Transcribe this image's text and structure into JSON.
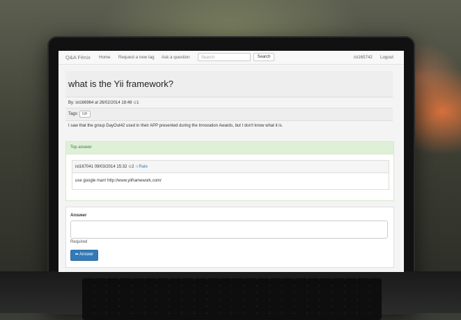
{
  "nav": {
    "brand": "Q&A Fénix",
    "links": [
      "Home",
      "Request a new tag",
      "Ask a question"
    ],
    "search_placeholder": "Search",
    "search_button": "Search",
    "user": "ist165742",
    "logout": "Logout"
  },
  "question": {
    "title": "what is the Yii framework?",
    "meta": "By: ist166964 at 26/02/2014 18:48 ",
    "votes": "1",
    "tags_label": "Tags:",
    "tags": [
      "GR"
    ],
    "body": "I saw that the group DayOut42 used in their APP presented during the Innovation Awards, but I don't know what it is."
  },
  "top_answer": {
    "heading": "Top answer",
    "author_line": "ist167041 09/03/2014 15:32 ",
    "votes": "2",
    "rate_label": "Rate",
    "text": "use google man! http://www.yiiframework.com/"
  },
  "answer_form": {
    "label": "Answer",
    "required": "Required",
    "submit": "Answer"
  },
  "colors": {
    "accent": "#337ab7",
    "success_bg": "#dff0d8"
  }
}
